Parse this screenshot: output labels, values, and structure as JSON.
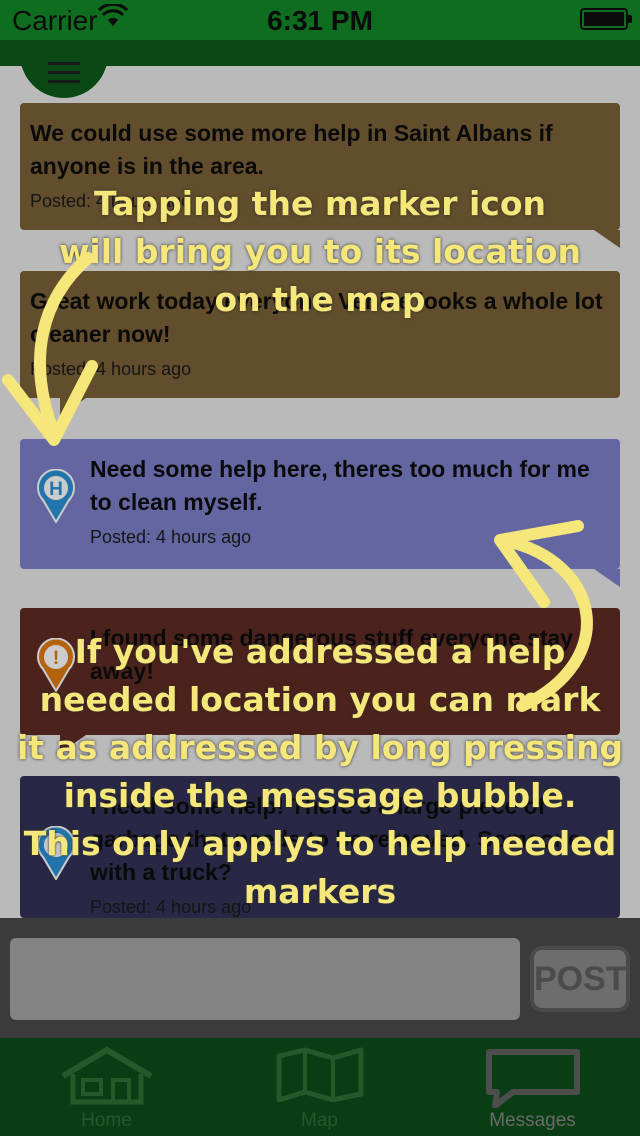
{
  "status_bar": {
    "carrier": "Carrier",
    "time": "6:31 PM"
  },
  "messages": [
    {
      "text": "We could use some more help in Saint Albans if anyone is in the area.",
      "posted": "Posted: 4 hours ago"
    },
    {
      "text": "Great work today everyone. Venice looks a whole lot cleaner now!",
      "posted": "Posted: 4 hours ago"
    },
    {
      "text": "Need some help here, theres too much for me to clean myself.",
      "posted": "Posted: 4 hours ago",
      "marker": "H"
    },
    {
      "text": "I found some dangerous stuff everyone stay away!",
      "marker": "!"
    },
    {
      "text": "I need some help! There's a large piece of garbage that needs to be removed. Someone with a truck?",
      "posted": "Posted: 4 hours ago"
    }
  ],
  "annotations": {
    "top": [
      "Tapping the marker icon",
      "will bring you to its location",
      "on the map"
    ],
    "bottom": [
      "If you've addressed a help",
      "needed location you can mark",
      "it as addressed by long pressing",
      "inside the message bubble.",
      "This only applys to help needed",
      "markers"
    ]
  },
  "composer": {
    "post_label": "POST"
  },
  "tabs": [
    {
      "label": "Home",
      "icon": "home-icon"
    },
    {
      "label": "Map",
      "icon": "map-icon"
    },
    {
      "label": "Messages",
      "icon": "messages-icon"
    }
  ],
  "colors": {
    "header_green": "#0e6d1e",
    "annotation_yellow": "#f5e77a",
    "help_bubble": "#7e80cb",
    "help_marker": "#2a93d5",
    "danger_marker": "#e07b12"
  }
}
